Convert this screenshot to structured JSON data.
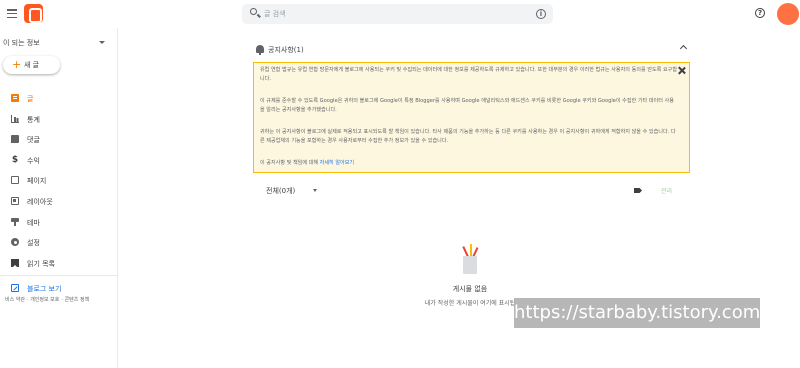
{
  "header": {
    "search_placeholder": "글 검색",
    "help_label": "?",
    "info_label": "i"
  },
  "sidebar": {
    "blog_name": "이 되는 정보",
    "new_post_label": "새 글",
    "items": [
      {
        "label": "글",
        "icon": "post-icon",
        "active": true
      },
      {
        "label": "통계",
        "icon": "stats-icon"
      },
      {
        "label": "댓글",
        "icon": "comment-icon"
      },
      {
        "label": "수익",
        "icon": "dollar-icon"
      },
      {
        "label": "페이지",
        "icon": "pages-icon"
      },
      {
        "label": "레이아웃",
        "icon": "layout-icon"
      },
      {
        "label": "테마",
        "icon": "theme-icon"
      },
      {
        "label": "설정",
        "icon": "settings-icon"
      },
      {
        "label": "읽기 목록",
        "icon": "reading-list-icon"
      }
    ],
    "view_blog_label": "블로그 보기",
    "footer": [
      "비스 약관",
      "개인정보 보호",
      "콘텐츠 정책"
    ]
  },
  "notice": {
    "title": "공지사항(1)",
    "paragraphs": [
      "유럽 연합 법규는 유럽 연합 방문자에게 블로그에 사용되는 쿠키 및 수집되는 데이터에 대한 정보를 제공하도록 규제하고 있습니다. 또한 대부분의 경우 이러한 법규는 사용자의 동의를 얻도록 요구합니다.",
      "이 규제를 준수할 수 있도록 Google은 귀하의 블로그에 Google이 특정 Blogger를 사용하며 Google 애널리틱스와 애드센스 쿠키를 비롯한 Google 쿠키와 Google이 수집한 기타 데이터 사용을 알리는 공지사항을 추가했습니다.",
      "귀하는 이 공지사항이 블로그에 실제로 적용되고 표시되도록 할 책임이 있습니다. 타사 제품의 기능을 추가하는 등 다른 쿠키를 사용하는 경우 이 공지사항이 귀하에게 적합하지 않을 수 있습니다. 다른 제공업체의 기능을 포함하는 경우 사용자로부터 수집한 추가 정보가 있을 수 있습니다.",
      "이 공지사항 및 책임에 대해 "
    ],
    "link_text": "자세히 알아보기"
  },
  "filter": {
    "selected": "전체(0개)",
    "manage_label": "관리"
  },
  "empty": {
    "title": "게시물 없음",
    "subtitle": "내가 작성한 게시물이 여기에 표시됩"
  },
  "watermark": "https://starbaby.tistory.com",
  "colors": {
    "accent": "#f57c00",
    "link": "#1a73e8",
    "notice_bg": "#fef7e0",
    "notice_border": "#fbbc04"
  }
}
